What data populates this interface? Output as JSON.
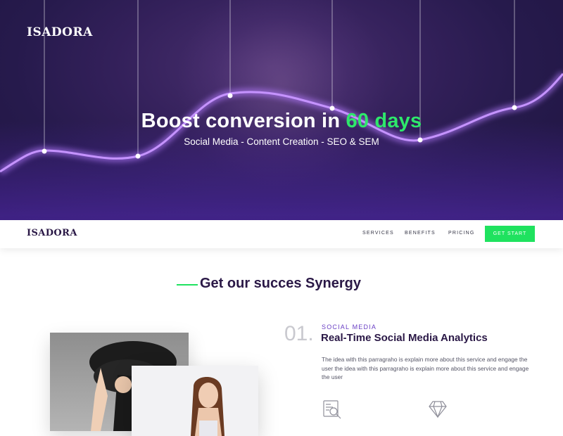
{
  "hero": {
    "logo": "ISADORA",
    "title_main": "Boost conversion in",
    "title_accent": "60 days",
    "subtitle": "Social Media - Content Creation - SEO & SEM"
  },
  "nav": {
    "logo": "ISADORA",
    "links": [
      "SERVICES",
      "BENEFITS",
      "PRICING"
    ],
    "cta": "GET START"
  },
  "section": {
    "title": "Get our succes Synergy"
  },
  "service": {
    "number": "01.",
    "category": "SOCIAL MEDIA",
    "title": "Real-Time Social Media Analytics",
    "description": "The idea with this parragraho is explain more about this service and engage the user  the idea with this parragraho is explain more about this service and engage the user"
  },
  "icons": [
    "analytics-document-icon",
    "diamond-icon"
  ],
  "colors": {
    "accent_green": "#1fe25f",
    "brand_purple": "#2a1846",
    "wave_purple": "#b57bff",
    "category_purple": "#6a3fc4"
  }
}
